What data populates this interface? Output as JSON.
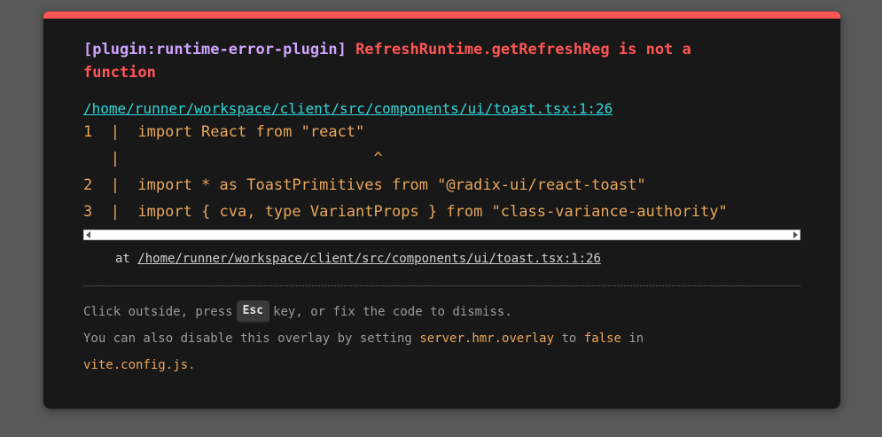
{
  "error": {
    "plugin": "[plugin:runtime-error-plugin]",
    "message": "RefreshRuntime.getRefreshReg is not a function",
    "file": "/home/runner/workspace/client/src/components/ui/toast.tsx:1:26"
  },
  "code_frame": [
    "1  |  import React from \"react\"",
    "   |                            ^",
    "2  |  import * as ToastPrimitives from \"@radix-ui/react-toast\"",
    "3  |  import { cva, type VariantProps } from \"class-variance-authority\""
  ],
  "stack": {
    "prefix": "at ",
    "file": "/home/runner/workspace/client/src/components/ui/toast.tsx:1:26"
  },
  "tip": {
    "part1": "Click outside, press",
    "key": "Esc",
    "part2": "key, or fix the code to dismiss.",
    "part3": "You can also disable this overlay by setting",
    "setting": "server.hmr.overlay",
    "part4": "to",
    "value": "false",
    "part5": "in",
    "config_file": "vite.config.js",
    "end": "."
  },
  "colors": {
    "accent_top_border": "#ff5555",
    "plugin": "#cfa4ff",
    "message": "#ff5555",
    "file_link": "#2dd9da",
    "code": "#e8a65c",
    "background": "#181818"
  }
}
